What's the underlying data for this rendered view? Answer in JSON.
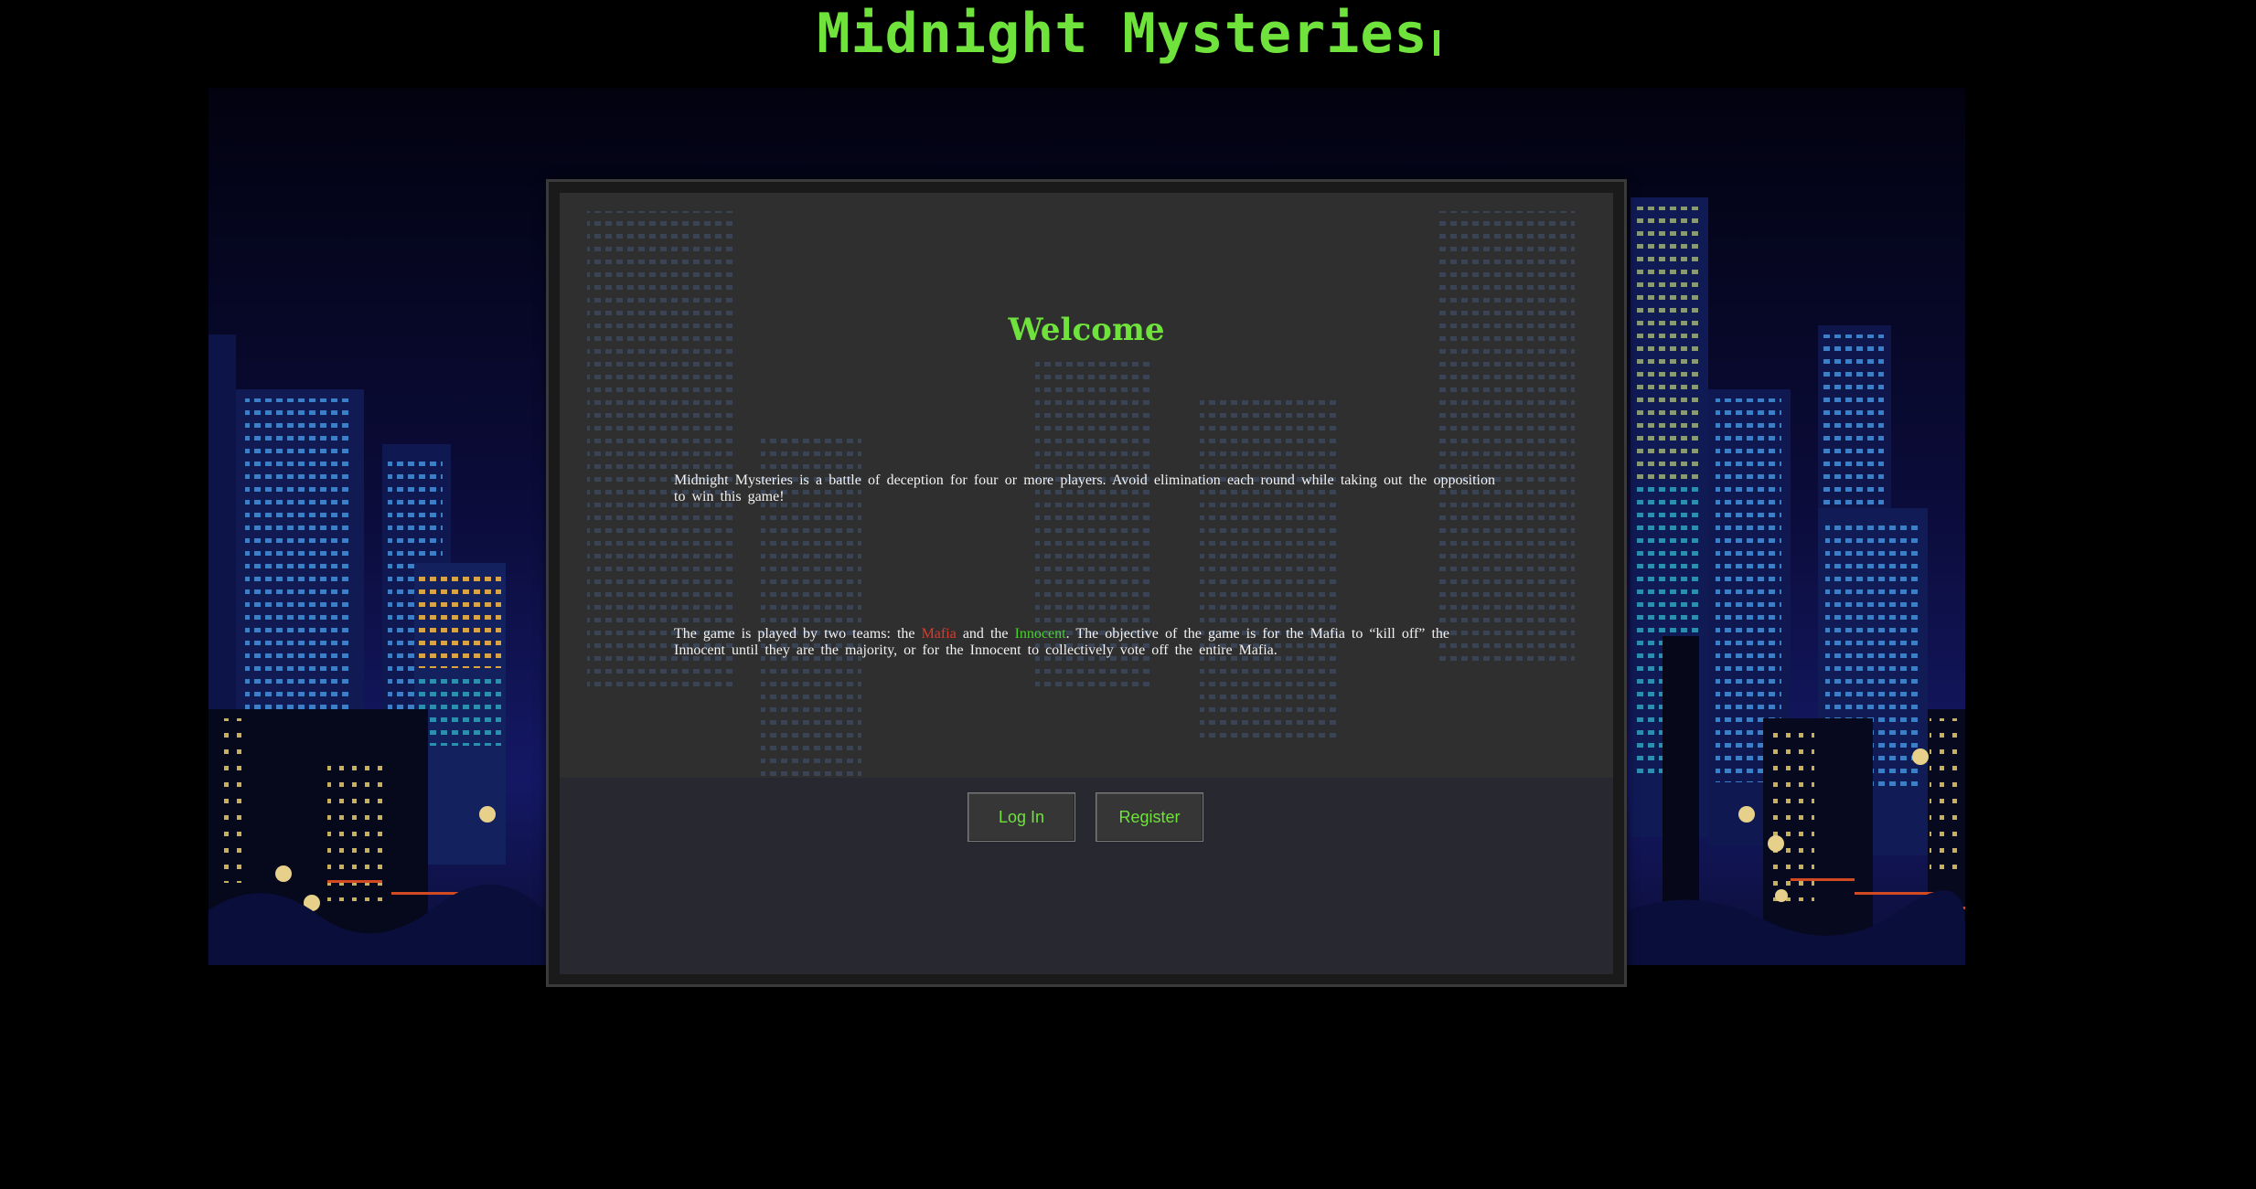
{
  "header": {
    "title": "Midnight Mysteries"
  },
  "panel": {
    "heading": "Welcome",
    "intro_paragraph": "Midnight Mysteries is a battle of deception for four or more players. Avoid elimination each round while taking out the opposition to win this game!",
    "rules": {
      "prefix": "The game is played by two teams: the ",
      "team_mafia": "Mafia",
      "joiner": " and the ",
      "team_innocent": "Innocent",
      "suffix": ". The objective of the game is for the Mafia to “kill off” the Innocent until they are the majority, or for the Innocent to collectively vote off the entire Mafia."
    },
    "buttons": {
      "login": "Log In",
      "register": "Register"
    }
  },
  "colors": {
    "accent_green": "#6fe23c",
    "mafia_red": "#e03a2a",
    "innocent_green": "#49d12e",
    "background": "#000000",
    "panel": "#323232"
  }
}
